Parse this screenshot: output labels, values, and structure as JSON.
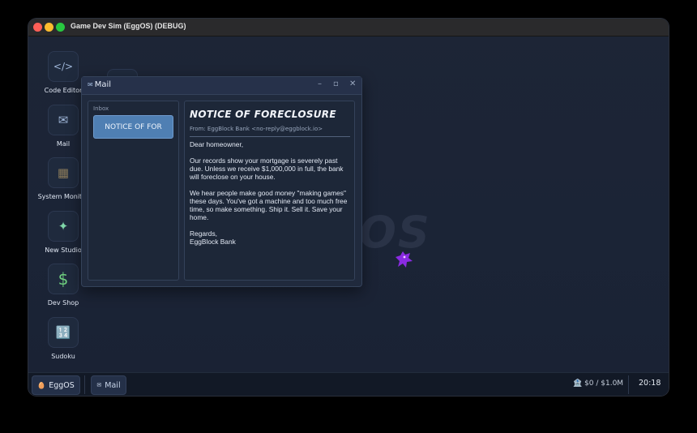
{
  "window": {
    "title": "Game Dev Sim (EggOS) (DEBUG)"
  },
  "desktop": {
    "watermark": "OS",
    "icons": [
      {
        "label": "Code Editor",
        "icon": "</>",
        "icon_name": "code-icon"
      },
      {
        "label": "Mail",
        "icon": "✉",
        "icon_name": "envelope-icon"
      },
      {
        "label": "System Monitor",
        "icon": "▦",
        "icon_name": "monitor-icon"
      },
      {
        "label": "New Studio",
        "icon": "✦",
        "icon_name": "sparkle-icon"
      },
      {
        "label": "Dev Shop",
        "icon": "$",
        "icon_name": "dollar-icon"
      },
      {
        "label": "Sudoku",
        "icon": "🔢",
        "icon_name": "sudoku-icon"
      }
    ]
  },
  "mail": {
    "title": "Mail",
    "controls": {
      "minimize": "–",
      "maximize": "▫",
      "close": "✕"
    },
    "inbox_label": "Inbox",
    "inbox_items": [
      "NOTICE OF FOR"
    ],
    "message": {
      "subject": "NOTICE OF FORECLOSURE",
      "from": "From: EggBlock Bank <no-reply@eggblock.io>",
      "greeting": "Dear homeowner,",
      "para1": "Our records show your mortgage is severely past due. Unless we receive $1,000,000 in full, the bank will foreclose on your house.",
      "para2": "We hear people make good money \"making games\" these days. You've got a machine and too much free time, so make something. Ship it. Sell it. Save your home.",
      "signoff": "Regards,",
      "signature": "EggBlock Bank"
    }
  },
  "taskbar": {
    "start_label": "EggOS",
    "start_icon": "🥚",
    "open_app_label": "Mail",
    "open_app_icon": "✉",
    "money": "🏦 $0 / $1.0M",
    "clock": "20:18"
  },
  "colors": {
    "accent": "#4f7fb3",
    "desktop_bg": "#1b2436",
    "taskbar_bg": "#121926",
    "cursor_purple": "#8a2be2"
  }
}
